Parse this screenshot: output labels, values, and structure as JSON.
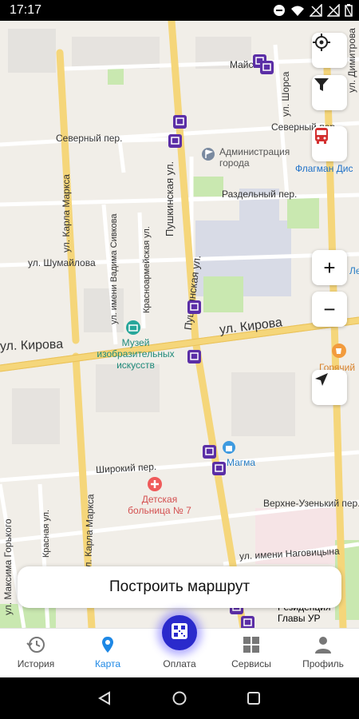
{
  "status_bar": {
    "time": "17:17"
  },
  "map": {
    "streets": {
      "mayskaya": "Майская",
      "dimitrova": "ул. Димитрова",
      "shorsa": "ул. Шорса",
      "severny_per_1": "Северный пер.",
      "severny_per_2": "Северный пер.",
      "pushkinskaya_1": "Пушкинская ул.",
      "pushkinskaya_2": "Пушкинская ул.",
      "karla_marksa_1": "ул. Карла Маркса",
      "karla_marksa_2": "ул. Карла Маркса",
      "razdelny": "Раздельный пер.",
      "shumaylova": "ул. Шумайлова",
      "sivkova": "ул. имени Вадима Сивкова",
      "krasnoarmeyskaya": "Красноармейская ул.",
      "kirova_1": "ул. Кирова",
      "kirova_2": "ул. Кирова",
      "shiroky": "Широкий пер.",
      "krasnaya": "Красная ул.",
      "maksima_gorkogo": "ул. Максима Горького",
      "verkhne_uzensky": "Верхне-Узенький пер.",
      "nagovitsyna": "ул. имени Наговицына"
    },
    "pois": {
      "administration": "Администрация города",
      "flagman": "Флагман Дис",
      "museum": "Музей изобразительных искусств",
      "hospital": "Детская больница № 7",
      "cafe": "Горячий",
      "shop": "Магма",
      "residence": "Резиденция Главы УР",
      "le": "Ле"
    }
  },
  "controls": {
    "locate": "target-icon",
    "filter": "filter-icon",
    "transport": "bus-icon",
    "zoom_in": "+",
    "zoom_out": "−",
    "navigate": "navigation-arrow-icon"
  },
  "route_button": {
    "label": "Построить маршрут"
  },
  "bottom_nav": [
    {
      "label": "История",
      "icon": "history-icon"
    },
    {
      "label": "Карта",
      "icon": "map-pin-icon",
      "active": true
    },
    {
      "label": "Оплата",
      "icon": "qr-pay-icon"
    },
    {
      "label": "Сервисы",
      "icon": "grid-icon"
    },
    {
      "label": "Профиль",
      "icon": "profile-icon"
    }
  ],
  "colors": {
    "accent": "#1e88e5",
    "pay": "#2a2acc",
    "bus_stop": "#5b2ea6",
    "road": "#f5d67a",
    "transport": "#d32f2f"
  }
}
